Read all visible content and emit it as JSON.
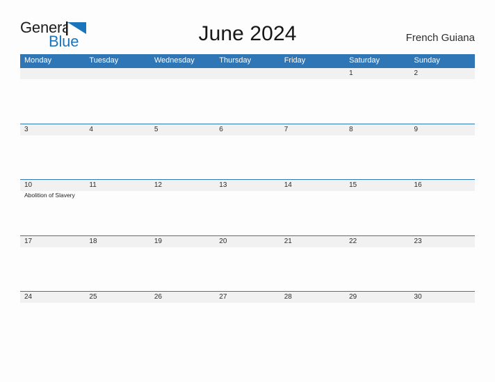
{
  "brand": {
    "name_part1": "General",
    "name_part2": "Blue",
    "flag_icon": "blue-flag-triangle",
    "accent_color": "#1c74bb"
  },
  "header": {
    "title": "June 2024",
    "region": "French Guiana"
  },
  "colors": {
    "header_blue": "#2f76b6",
    "date_band_gray": "#f1f1f1",
    "page_background": "#fdfdfd",
    "text_dark": "#1c1c1c"
  },
  "calendar": {
    "weekdays": [
      "Monday",
      "Tuesday",
      "Wednesday",
      "Thursday",
      "Friday",
      "Saturday",
      "Sunday"
    ],
    "weeks": [
      [
        {
          "date": "",
          "events": []
        },
        {
          "date": "",
          "events": []
        },
        {
          "date": "",
          "events": []
        },
        {
          "date": "",
          "events": []
        },
        {
          "date": "",
          "events": []
        },
        {
          "date": "1",
          "events": []
        },
        {
          "date": "2",
          "events": []
        }
      ],
      [
        {
          "date": "3",
          "events": []
        },
        {
          "date": "4",
          "events": []
        },
        {
          "date": "5",
          "events": []
        },
        {
          "date": "6",
          "events": []
        },
        {
          "date": "7",
          "events": []
        },
        {
          "date": "8",
          "events": []
        },
        {
          "date": "9",
          "events": []
        }
      ],
      [
        {
          "date": "10",
          "events": [
            "Abolition of Slavery"
          ]
        },
        {
          "date": "11",
          "events": []
        },
        {
          "date": "12",
          "events": []
        },
        {
          "date": "13",
          "events": []
        },
        {
          "date": "14",
          "events": []
        },
        {
          "date": "15",
          "events": []
        },
        {
          "date": "16",
          "events": []
        }
      ],
      [
        {
          "date": "17",
          "events": []
        },
        {
          "date": "18",
          "events": []
        },
        {
          "date": "19",
          "events": []
        },
        {
          "date": "20",
          "events": []
        },
        {
          "date": "21",
          "events": []
        },
        {
          "date": "22",
          "events": []
        },
        {
          "date": "23",
          "events": []
        }
      ],
      [
        {
          "date": "24",
          "events": []
        },
        {
          "date": "25",
          "events": []
        },
        {
          "date": "26",
          "events": []
        },
        {
          "date": "27",
          "events": []
        },
        {
          "date": "28",
          "events": []
        },
        {
          "date": "29",
          "events": []
        },
        {
          "date": "30",
          "events": []
        }
      ]
    ]
  }
}
